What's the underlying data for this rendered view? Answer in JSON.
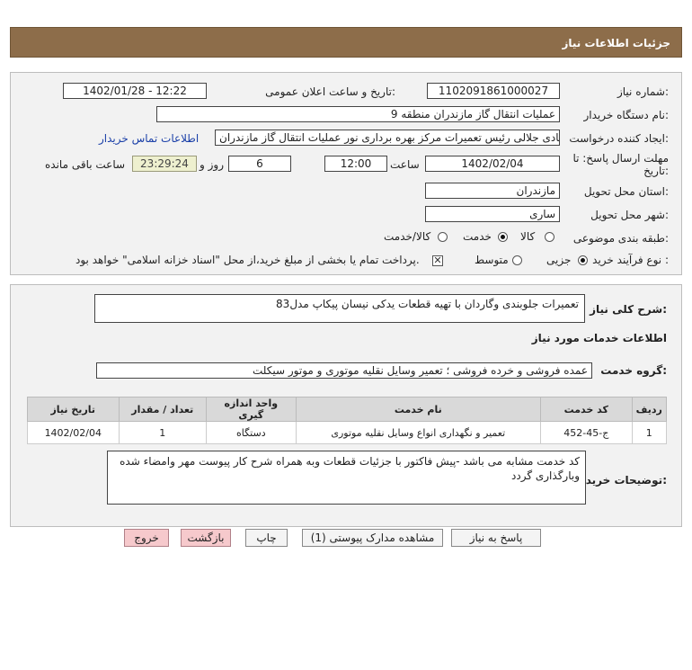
{
  "header": {
    "title": "جزئیات اطلاعات نیاز"
  },
  "form": {
    "need_number_label": "شماره نیاز:",
    "need_number": "1102091861000027",
    "announce_label": "تاریخ و ساعت اعلان عمومی:",
    "announce_value": "1402/01/28 - 12:22",
    "buyer_label": "نام دستگاه خریدار:",
    "buyer_value": "عملیات انتقال گاز مازندران منطقه 9",
    "creator_label": "ایجاد کننده درخواست:",
    "creator_value": "سیدهادی جلالی رئیس تعمیرات مرکز بهره برداری نور عملیات انتقال گاز مازندران",
    "contact_link": "اطلاعات تماس خریدار",
    "deadline_label_1": "مهلت ارسال پاسخ: تا",
    "deadline_label_2": "تاریخ:",
    "deadline_date": "1402/02/04",
    "time_label": "ساعت",
    "deadline_time": "12:00",
    "days_value": "6",
    "days_label": "روز و",
    "remaining_timer": "23:29:24",
    "remaining_label": "ساعت باقی مانده",
    "province_label": "استان محل تحویل:",
    "province_value": "مازندران",
    "city_label": "شهر محل تحویل:",
    "city_value": "ساری",
    "category_label": "طبقه بندی موضوعی:",
    "category_options": [
      "کالا",
      "خدمت",
      "کالا/خدمت"
    ],
    "category_selected": "خدمت",
    "process_label": "نوع فرآیند خرید :",
    "process_options": [
      "جزیی",
      "متوسط"
    ],
    "process_selected": "جزیی",
    "payment_text": "پرداخت تمام یا بخشی از مبلغ خرید،از محل \"اسناد خزانه اسلامی\" خواهد بود."
  },
  "description": {
    "label": "شرح کلی نیاز:",
    "value": "تعمیرات جلوبندی وگاردان با تهیه قطعات یدکی نیسان پیکاپ مدل83",
    "services_heading": "اطلاعات خدمات مورد نیاز",
    "group_label": "گروه خدمت:",
    "group_value": "عمده فروشی و خرده فروشی ؛ تعمیر وسایل نقلیه موتوری و موتور سیکلت"
  },
  "table": {
    "headers": [
      "ردیف",
      "کد خدمت",
      "نام خدمت",
      "واحد اندازه گیری",
      "تعداد / مقدار",
      "تاریخ نیاز"
    ],
    "rows": [
      [
        "1",
        "ج-45-452",
        "تعمیر و نگهداری انواع وسایل نقلیه موتوری",
        "دستگاه",
        "1",
        "1402/02/04"
      ]
    ]
  },
  "buyer_notes": {
    "label": "توضیحات خریدار:",
    "value": "کد خدمت مشابه می باشد -پیش فاکتور با جزئیات قطعات وبه همراه شرح کار پیوست مهر وامضاء شده وبارگذاری گردد"
  },
  "buttons": {
    "reply": "پاسخ به نیاز",
    "view_docs": "مشاهده مدارک پیوستی (1)",
    "print": "چاپ",
    "back": "بازگشت",
    "exit": "خروج"
  },
  "colors": {
    "header_bg": "#8d6d4a",
    "exit_btn": "#f6c9cc",
    "link": "#1a3fa8"
  }
}
